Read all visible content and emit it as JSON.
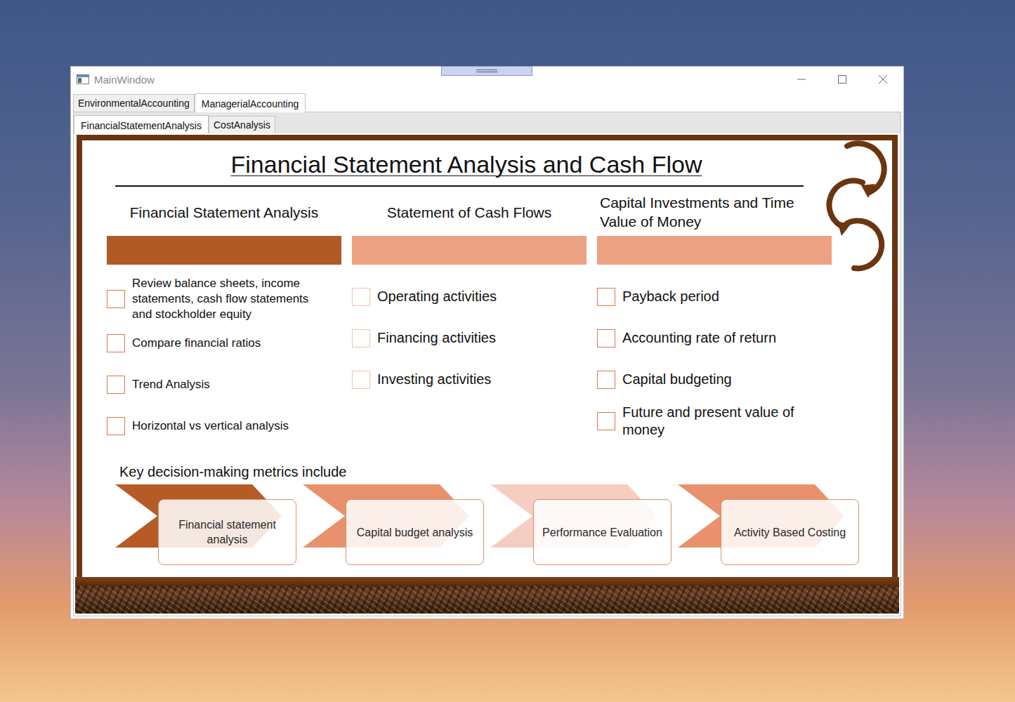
{
  "window": {
    "title": "MainWindow"
  },
  "tabs": [
    {
      "label": "EnvironmentalAccounting",
      "selected": false
    },
    {
      "label": "ManagerialAccounting",
      "selected": true
    }
  ],
  "subtabs": [
    {
      "label": "FinancialStatementAnalysis",
      "selected": true
    },
    {
      "label": "CostAnalysis",
      "selected": false
    }
  ],
  "page": {
    "title": "Financial Statement Analysis and Cash Flow",
    "columns": [
      {
        "header": "Financial Statement Analysis",
        "color": "#b05a25",
        "items": [
          {
            "label": "Review balance sheets, income statements, cash flow statements and stockholder equity",
            "checked": false
          },
          {
            "label": "Compare financial ratios",
            "checked": false
          },
          {
            "label": "Trend Analysis",
            "checked": false
          },
          {
            "label": "Horizontal vs vertical analysis",
            "checked": false
          }
        ]
      },
      {
        "header": "Statement of Cash Flows",
        "color": "#eda283",
        "items": [
          {
            "label": "Operating activities",
            "checked": false
          },
          {
            "label": "Financing activities",
            "checked": false
          },
          {
            "label": "Investing activities",
            "checked": false
          }
        ]
      },
      {
        "header": "Capital Investments and Time Value of Money",
        "color": "#eda283",
        "items": [
          {
            "label": "Payback period",
            "checked": false
          },
          {
            "label": "Accounting rate of return",
            "checked": false
          },
          {
            "label": "Capital budgeting",
            "checked": false
          },
          {
            "label": "Future and present value of money",
            "checked": false
          }
        ]
      }
    ],
    "metrics_heading": "Key decision-making metrics include",
    "metrics": [
      {
        "label": "Financial statement analysis",
        "color": "#b65a26"
      },
      {
        "label": "Capital budget analysis",
        "color": "#e8916c"
      },
      {
        "label": "Performance Evaluation",
        "color": "#f5cdc1"
      },
      {
        "label": "Activity Based Costing",
        "color": "#e8916c"
      }
    ]
  }
}
